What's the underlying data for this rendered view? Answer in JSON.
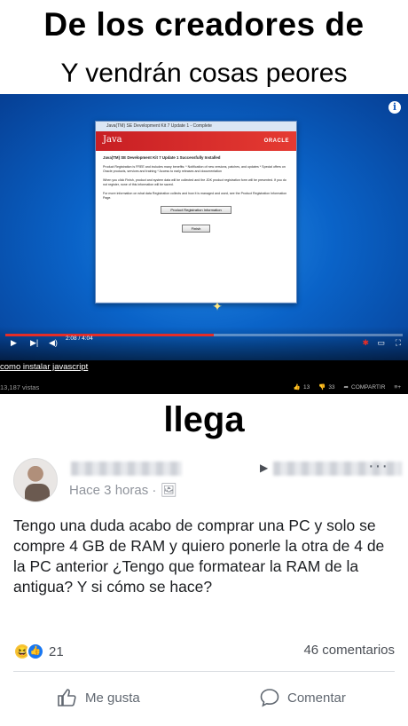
{
  "meme": {
    "top_caption": "De los creadores de",
    "sub_caption": "Y vendrán cosas peores",
    "middle_caption": "llega"
  },
  "video": {
    "window_title": "Java(TM) SE Development Kit 7 Update 1 - Complete",
    "java_label": "Java",
    "oracle_label": "ORACLE",
    "dialog_heading": "Java(TM) SE Development Kit 7 Update 1 Successfully Installed",
    "dialog_text_1": "Product Registration is FREE and includes many benefits: * Notification of new versions, patches, and updates * Special offers on Oracle products, services and training * Access to early releases and documentation",
    "dialog_text_2": "When you click Finish, product and system data will be collected and the JDK product registration form will be presented. If you do not register, none of this information will be saved.",
    "dialog_text_3": "For more information on what data Registration collects and how it is managed and used, see the Product Registration Information Page.",
    "btn_registration": "Product Registration Information",
    "btn_finish": "Finish",
    "time_display": "2:08 / 4:04",
    "progress_fraction": 0.525,
    "title": "como instalar javascript",
    "views": "13,187 vistas",
    "likes": "13",
    "dislikes": "33",
    "share_label": "COMPARTIR",
    "accent_color": "#e52d27"
  },
  "post": {
    "time": "Hace 3 horas ·",
    "text": "Tengo una duda acabo de comprar una PC y solo se compre 4 GB de RAM y quiero ponerle la otra de 4 de la PC anterior ¿Tengo que formatear la RAM de la antigua? Y si cómo se hace?",
    "reaction_count": "21",
    "comments_count": "46 comentarios",
    "like_label": "Me gusta",
    "comment_label": "Comentar",
    "brand_color": "#1877f2"
  }
}
